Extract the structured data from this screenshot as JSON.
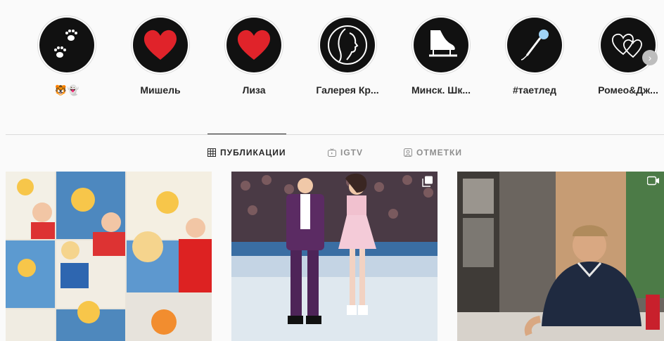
{
  "highlights": [
    {
      "label": "🐯👻",
      "icon": "paw-icon"
    },
    {
      "label": "Мишель",
      "icon": "heart-icon"
    },
    {
      "label": "Лиза",
      "icon": "heart-icon"
    },
    {
      "label": "Галерея Кр...",
      "icon": "face-profile-icon"
    },
    {
      "label": "Минск. Шк...",
      "icon": "skate-icon"
    },
    {
      "label": "#таетлед",
      "icon": "microphone-icon"
    },
    {
      "label": "Ромео&Дж...",
      "icon": "double-heart-icon"
    }
  ],
  "tabs": [
    {
      "label": "ПУБЛИКАЦИИ",
      "icon": "grid-icon",
      "active": true
    },
    {
      "label": "IGTV",
      "icon": "igtv-icon",
      "active": false
    },
    {
      "label": "ОТМЕТКИ",
      "icon": "tagged-icon",
      "active": false
    }
  ],
  "posts": [
    {
      "kind": "collage",
      "badge": "none"
    },
    {
      "kind": "ice-show",
      "badge": "carousel-icon"
    },
    {
      "kind": "signing",
      "badge": "video-icon"
    }
  ],
  "colors": {
    "heart": "#e0232a",
    "accent_text": "#262626",
    "muted": "#8e8e8e"
  }
}
